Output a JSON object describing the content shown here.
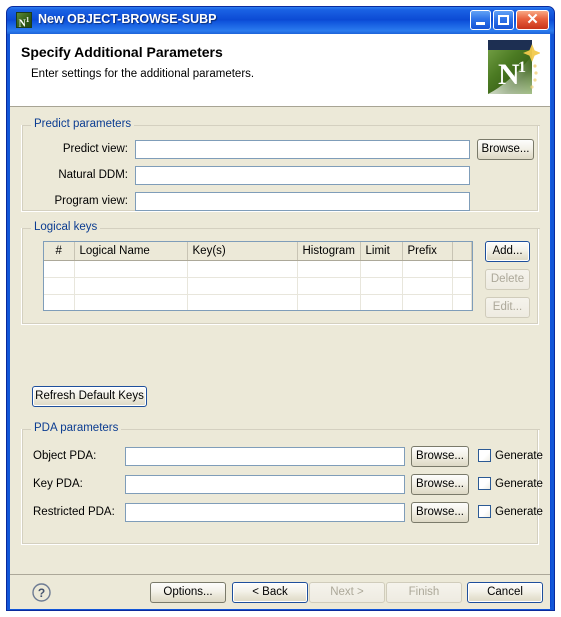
{
  "window": {
    "title": "New OBJECT-BROWSE-SUBP",
    "app_icon": "natural-n1-icon",
    "minimize_label": "Minimize",
    "maximize_label": "Maximize",
    "close_label": "Close",
    "close_glyph": "✕"
  },
  "header": {
    "title": "Specify Additional Parameters",
    "subtitle": "Enter settings for the additional parameters.",
    "banner_icon": "natural-n1-banner-logo",
    "banner_letter": "N",
    "banner_sup": "1"
  },
  "predict_group": {
    "legend": "Predict parameters",
    "fields": [
      {
        "label": "Predict view:",
        "value": "",
        "placeholder": "",
        "has_browse": true,
        "browse_label": "Browse..."
      },
      {
        "label": "Natural DDM:",
        "value": "",
        "placeholder": "",
        "has_browse": false,
        "browse_label": ""
      },
      {
        "label": "Program view:",
        "value": "",
        "placeholder": "",
        "has_browse": false,
        "browse_label": ""
      }
    ]
  },
  "logical_keys_group": {
    "legend": "Logical keys",
    "columns": [
      "#",
      "Logical Name",
      "Key(s)",
      "Histogram",
      "Limit",
      "Prefix",
      ""
    ],
    "rows": [],
    "empty_row_count": 5,
    "buttons": [
      {
        "label": "Add...",
        "enabled": true
      },
      {
        "label": "Delete",
        "enabled": false
      },
      {
        "label": "Edit...",
        "enabled": false
      }
    ]
  },
  "refresh_button": {
    "label": "Refresh Default Keys",
    "enabled": true
  },
  "pda_group": {
    "legend": "PDA parameters",
    "rows": [
      {
        "label": "Object PDA:",
        "value": "",
        "browse_label": "Browse...",
        "checkbox_label": "Generate",
        "checked": false
      },
      {
        "label": "Key PDA:",
        "value": "",
        "browse_label": "Browse...",
        "checkbox_label": "Generate",
        "checked": false
      },
      {
        "label": "Restricted PDA:",
        "value": "",
        "browse_label": "Browse...",
        "checkbox_label": "Generate",
        "checked": false
      }
    ]
  },
  "footer": {
    "help_icon": "help-question-icon",
    "help_glyph": "?",
    "buttons": [
      {
        "label": "Options...",
        "enabled": true,
        "focused": false
      },
      {
        "label": "< Back",
        "enabled": true,
        "focused": true
      },
      {
        "label": "Next >",
        "enabled": false,
        "focused": false
      },
      {
        "label": "Finish",
        "enabled": false,
        "focused": false
      },
      {
        "label": "Cancel",
        "enabled": true,
        "focused": true
      }
    ]
  },
  "colors": {
    "title_bar": "#0c4ad4",
    "legend_text": "#0b3c91",
    "dialog_bg": "#ece9d8",
    "field_border": "#7f9db9",
    "brand_green": "#3f6b1e"
  }
}
